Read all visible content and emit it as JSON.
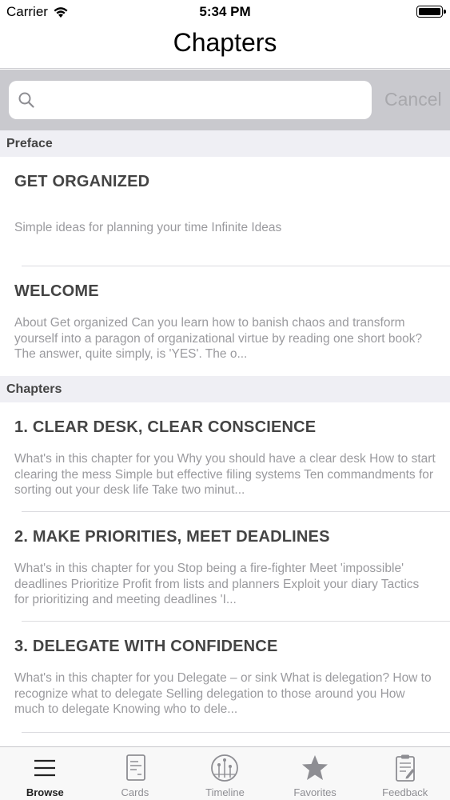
{
  "status_bar": {
    "carrier": "Carrier",
    "time": "5:34 PM"
  },
  "nav": {
    "title": "Chapters"
  },
  "search": {
    "placeholder": "",
    "cancel_label": "Cancel"
  },
  "sections": [
    {
      "header": "Preface",
      "rows": [
        {
          "title": "GET ORGANIZED",
          "desc": "Simple ideas for planning your time Infinite Ideas"
        },
        {
          "title": "WELCOME",
          "desc": "About Get organized Can you learn how to banish chaos and transform yourself into a paragon of organizational virtue by reading one short book? The answer, quite simply, is 'YES'. The o..."
        }
      ]
    },
    {
      "header": "Chapters",
      "rows": [
        {
          "title": "1. CLEAR DESK, CLEAR CONSCIENCE",
          "desc": "What's in this chapter for you Why you should have a clear desk How to start clearing the mess Simple but effective filing systems Ten commandments for sorting out your desk life Take two minut..."
        },
        {
          "title": "2. MAKE PRIORITIES, MEET DEADLINES",
          "desc": "What's in this chapter for you Stop being a fire-fighter Meet 'impossible' deadlines Prioritize Profit from lists and planners Exploit your diary Tactics for prioritizing and meeting deadlines 'I..."
        },
        {
          "title": "3. DELEGATE WITH CONFIDENCE",
          "desc": "What's in this chapter for you Delegate – or sink What is delegation? How to recognize what to delegate Selling delegation to those around you How much to delegate Knowing who to dele..."
        }
      ]
    }
  ],
  "tabs": [
    {
      "label": "Browse",
      "icon": "list-icon",
      "active": true
    },
    {
      "label": "Cards",
      "icon": "cards-icon",
      "active": false
    },
    {
      "label": "Timeline",
      "icon": "timeline-icon",
      "active": false
    },
    {
      "label": "Favorites",
      "icon": "star-icon",
      "active": false
    },
    {
      "label": "Feedback",
      "icon": "clipboard-icon",
      "active": false
    }
  ],
  "colors": {
    "section_bg": "#efeff4",
    "search_bg": "#c9c9ce",
    "title_text": "#444444",
    "desc_text": "#9a9a9e"
  }
}
